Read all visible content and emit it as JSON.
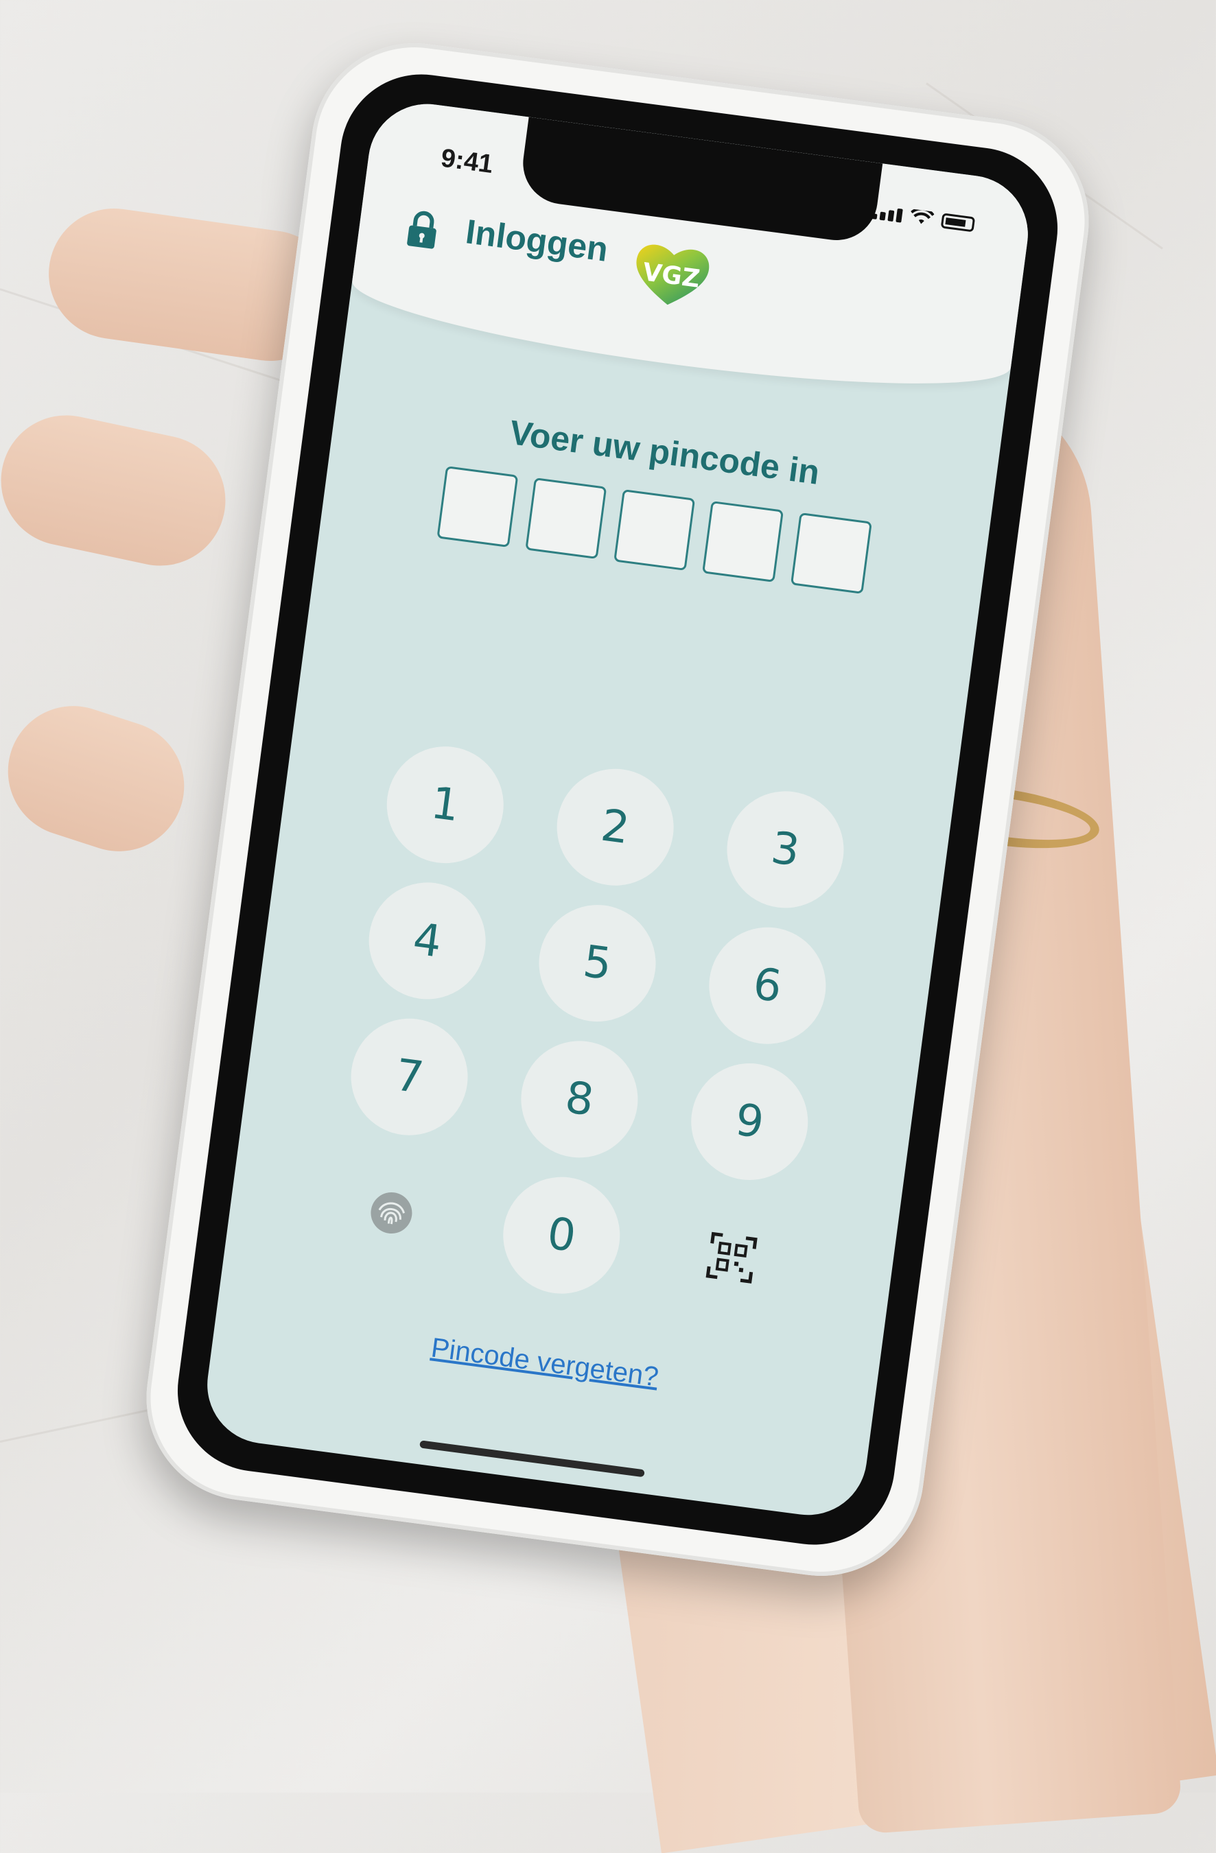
{
  "status_bar": {
    "time": "9:41"
  },
  "header": {
    "title": "Inloggen",
    "lock_icon": "lock-icon",
    "logo_text": "VGZ"
  },
  "pin": {
    "prompt": "Voer uw pincode in",
    "digit_count": 5
  },
  "keypad": {
    "keys": [
      "1",
      "2",
      "3",
      "4",
      "5",
      "6",
      "7",
      "8",
      "9",
      "0"
    ],
    "fingerprint_icon": "fingerprint-icon",
    "qr_icon": "qr-code-icon"
  },
  "links": {
    "forgot_pin": "Pincode vergeten?"
  },
  "colors": {
    "primary": "#1f6e70",
    "screen_background": "#d2e4e3",
    "header_background": "#f1f3f2",
    "link": "#2a76c8"
  }
}
